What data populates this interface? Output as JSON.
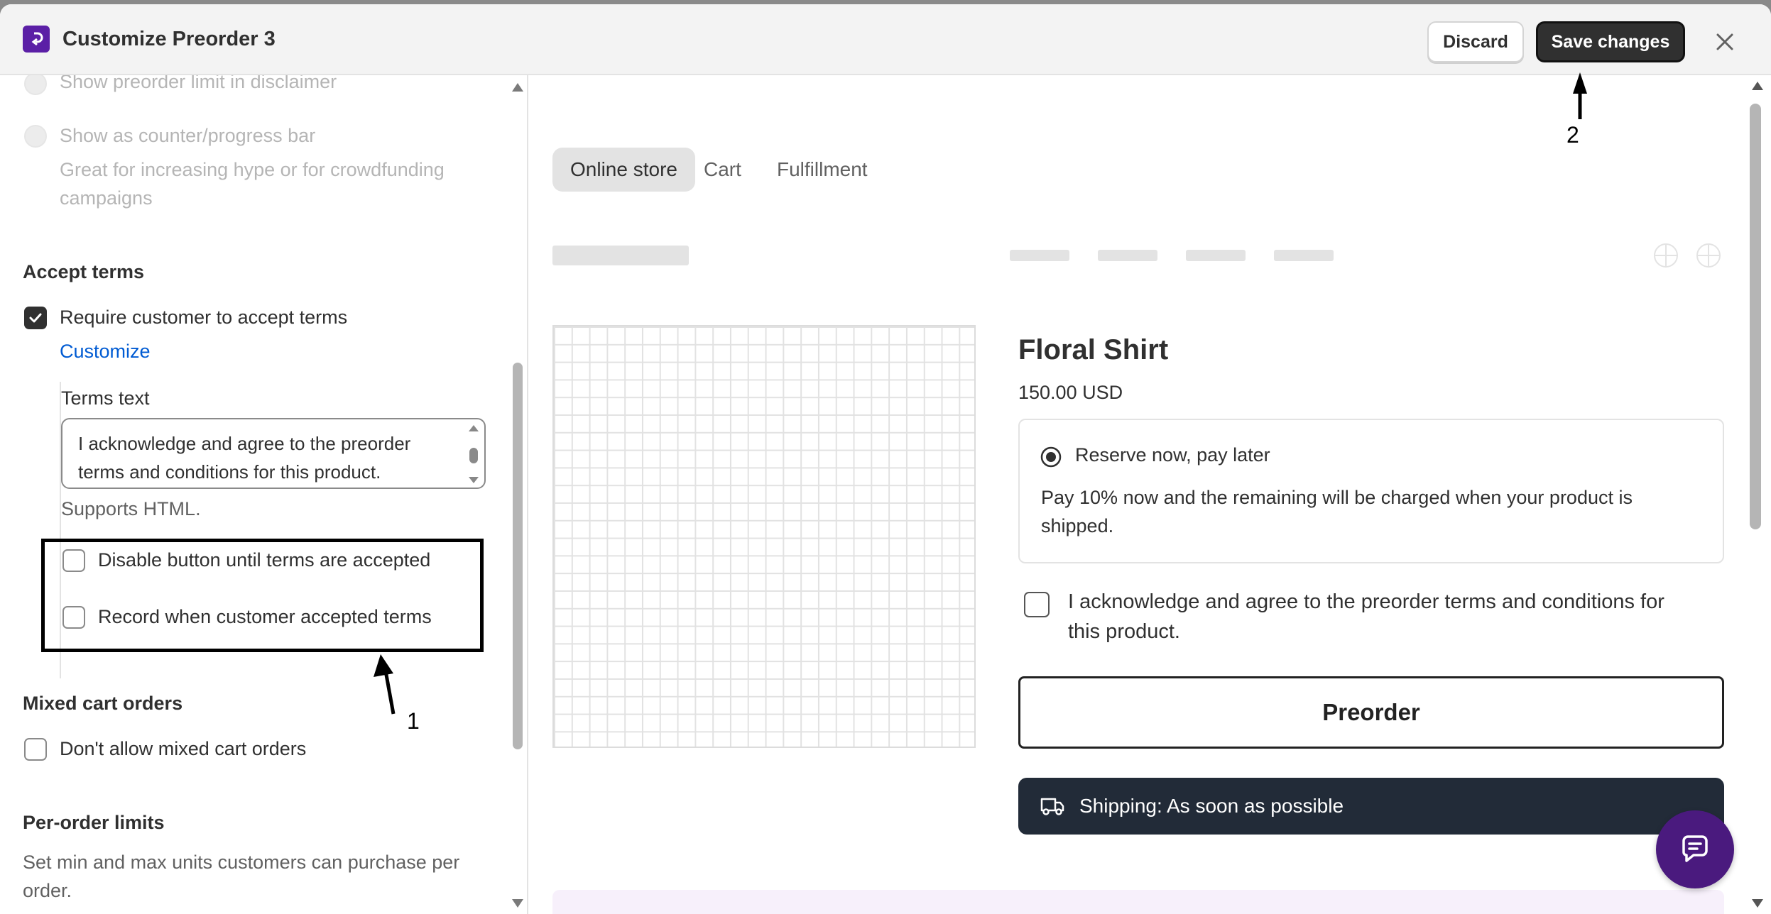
{
  "header": {
    "title": "Customize Preorder 3",
    "discard_label": "Discard",
    "save_label": "Save changes"
  },
  "left": {
    "preorder_limit_label": "Show preorder limit in disclaimer",
    "counter_label": "Show as counter/progress bar",
    "counter_help_line1": "Great for increasing hype or for crowdfunding",
    "counter_help_line2": "campaigns",
    "accept_terms_title": "Accept terms",
    "require_terms_label": "Require customer to accept terms",
    "require_terms_checked": true,
    "customize_link": "Customize",
    "terms_text_label": "Terms text",
    "terms_text_value": "I acknowledge and agree to the preorder terms and conditions for this product.",
    "supports_html": "Supports HTML.",
    "disable_button_label": "Disable button until terms are accepted",
    "record_label": "Record when customer accepted terms",
    "mixed_cart_title": "Mixed cart orders",
    "mixed_cart_label": "Don't allow mixed cart orders",
    "per_order_title": "Per-order limits",
    "per_order_help_line1": "Set min and max units customers can purchase per",
    "per_order_help_line2": "order."
  },
  "preview": {
    "tabs": [
      "Online store",
      "Cart",
      "Fulfillment"
    ],
    "active_tab": "Online store",
    "product_title": "Floral Shirt",
    "product_price": "150.00 USD",
    "option_label": "Reserve now, pay later",
    "option_desc_line1": "Pay 10% now and the remaining will be charged when your product is",
    "option_desc_line2": "shipped.",
    "terms_line1": "I acknowledge and agree to the preorder terms and conditions for",
    "terms_line2": "this product.",
    "preorder_button": "Preorder",
    "shipping_text": "Shipping: As soon as possible"
  },
  "annotations": {
    "label_1": "1",
    "label_2": "2"
  },
  "colors": {
    "brand": "#5b1fa6",
    "link": "#005bd3",
    "primary_button": "#303030",
    "shipping_bar": "#222b38",
    "chat_fab": "#4a1a7e"
  }
}
